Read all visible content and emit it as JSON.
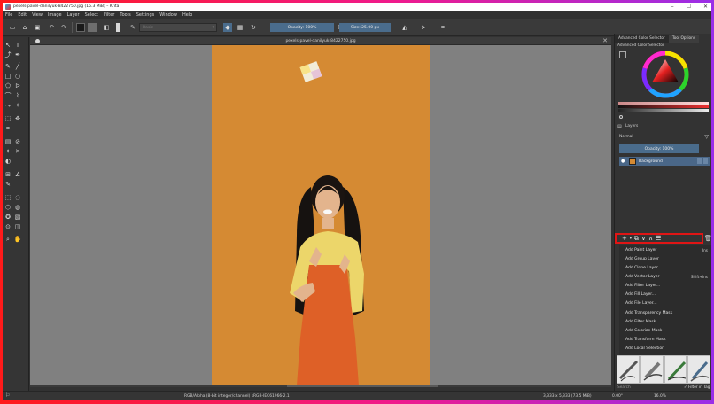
{
  "window": {
    "title": "pexels-pavel-danilyuk-8422750.jpg (15.3 MiB)  – Krita",
    "minimize": "–",
    "maximize": "☐",
    "close": "✕"
  },
  "menubar": [
    "File",
    "Edit",
    "View",
    "Image",
    "Layer",
    "Select",
    "Filter",
    "Tools",
    "Settings",
    "Window",
    "Help"
  ],
  "toolbar": {
    "preset_placeholder": "Basic",
    "opacity_label": "Opacity: 100%",
    "size_label": "Size: 25.00 px"
  },
  "document": {
    "tab_title": "pexels-pavel-danilyuk-8422750.jpg",
    "close": "✕"
  },
  "right_dock": {
    "tabs": [
      "Advanced Color Selector",
      "Tool Options"
    ],
    "color_panel_title": "Advanced Color Selector",
    "layers_title": "Layers",
    "blend_mode": "Normal",
    "layer_opacity": "Opacity:  100%",
    "layer_name": "Background",
    "context_menu": [
      {
        "label": "Add Paint Layer",
        "shortcut": "Ins"
      },
      {
        "label": "Add Group Layer",
        "shortcut": ""
      },
      {
        "label": "Add Clone Layer",
        "shortcut": ""
      },
      {
        "label": "Add Vector Layer",
        "shortcut": "Shift+Ins"
      },
      {
        "label": "Add Filter Layer...",
        "shortcut": ""
      },
      {
        "label": "Add Fill Layer...",
        "shortcut": ""
      },
      {
        "label": "Add File Layer...",
        "shortcut": ""
      },
      {
        "label": "Add Transparency Mask",
        "shortcut": ""
      },
      {
        "label": "Add Filter Mask...",
        "shortcut": ""
      },
      {
        "label": "Add Colorize Mask",
        "shortcut": ""
      },
      {
        "label": "Add Transform Mask",
        "shortcut": ""
      },
      {
        "label": "Add Local Selection",
        "shortcut": ""
      }
    ],
    "search_placeholder": "Search",
    "filter_in_tag": "Filter in Tag"
  },
  "status": {
    "color_space": "RGB/Alpha (8-bit integer/channel)  sRGB-IEC61966-2.1",
    "dimensions": "3,333 x 5,333 (73.5 MiB)",
    "rotation": "0.00°",
    "zoom": "16.0%"
  },
  "colors": {
    "accent": "#4a6c8c",
    "highlight_box": "#e01515",
    "photo_background": "#d58a33"
  }
}
